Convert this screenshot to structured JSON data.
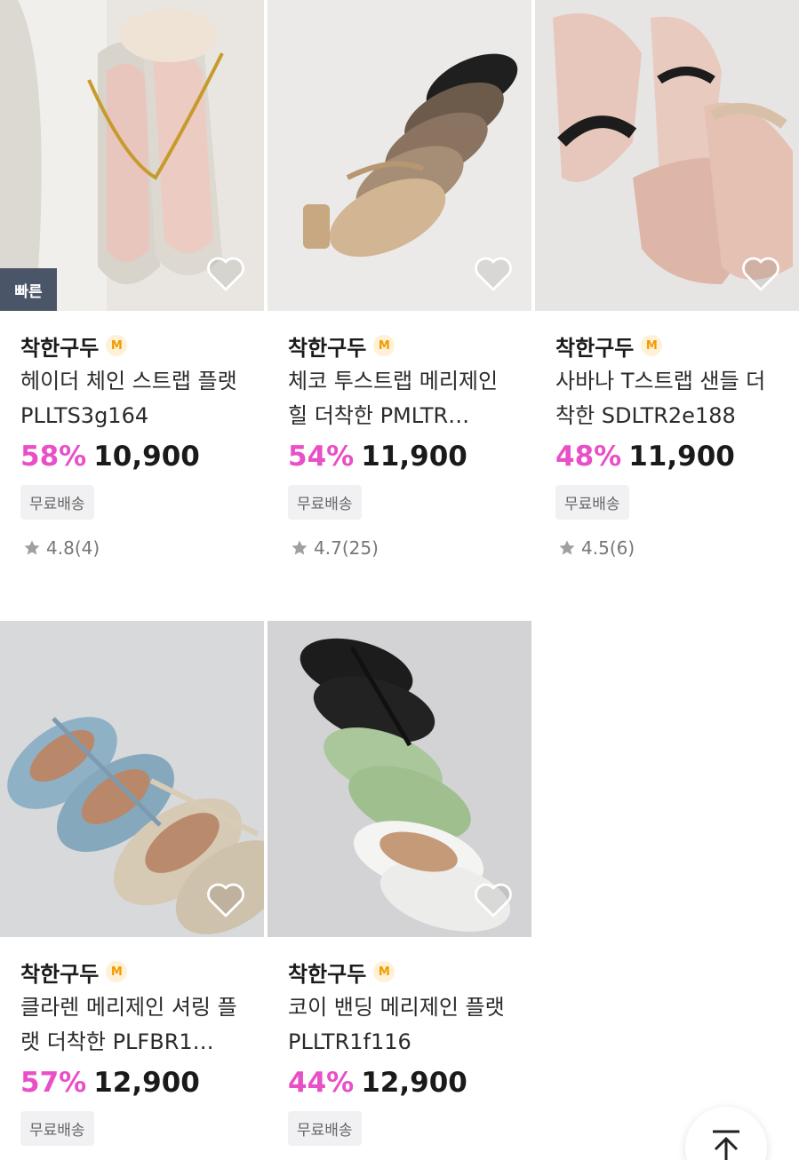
{
  "products": [
    {
      "brand": "착한구두",
      "badge": "M",
      "title": "헤이더 체인 스트랩 플랫 PLLTS3g164",
      "discount": "58%",
      "price": "10,900",
      "shipping": "무료배송",
      "rating": "4.8",
      "reviews": "(4)",
      "fast_badge": "빠른"
    },
    {
      "brand": "착한구두",
      "badge": "M",
      "title": "체코 투스트랩 메리제인힐 더착한 PMLTR…",
      "discount": "54%",
      "price": "11,900",
      "shipping": "무료배송",
      "rating": "4.7",
      "reviews": "(25)"
    },
    {
      "brand": "착한구두",
      "badge": "M",
      "title": "사바나 T스트랩 샌들 더착한 SDLTR2e188",
      "discount": "48%",
      "price": "11,900",
      "shipping": "무료배송",
      "rating": "4.5",
      "reviews": "(6)"
    },
    {
      "brand": "착한구두",
      "badge": "M",
      "title": "클라렌 메리제인 셔링 플랫 더착한 PLFBR1…",
      "discount": "57%",
      "price": "12,900",
      "shipping": "무료배송"
    },
    {
      "brand": "착한구두",
      "badge": "M",
      "title": "코이 밴딩 메리제인 플랫 PLLTR1f116",
      "discount": "44%",
      "price": "12,900",
      "shipping": "무료배송"
    }
  ],
  "icons": {
    "wishlist": "heart-outline-icon",
    "rating": "star-icon",
    "scroll_top": "arrow-up-to-top-icon"
  },
  "colors": {
    "discount": "#e94fc6",
    "badge_bg": "#fff1d6",
    "badge_fg": "#f29a00",
    "fast_badge_bg": "#4a5568"
  }
}
